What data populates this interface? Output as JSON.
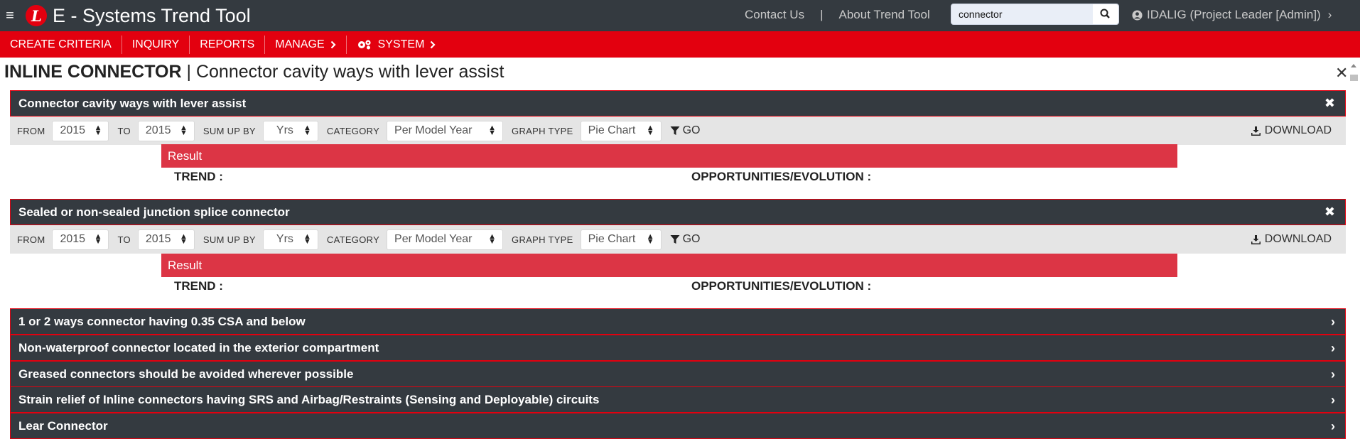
{
  "app": {
    "title": "E - Systems Trend Tool",
    "logo_letter": "L"
  },
  "header": {
    "contact_label": "Contact Us",
    "separator": "|",
    "about_label": "About Trend Tool",
    "search": {
      "value": "connector"
    },
    "user_label": "IDALIG (Project Leader [Admin])"
  },
  "nav": {
    "items": [
      {
        "label": "CREATE CRITERIA"
      },
      {
        "label": "INQUIRY"
      },
      {
        "label": "REPORTS"
      },
      {
        "label": "MANAGE"
      },
      {
        "label": "SYSTEM"
      }
    ]
  },
  "page": {
    "title_bold": "INLINE CONNECTOR",
    "title_sep": " | ",
    "title_rest": "Connector cavity ways with lever assist"
  },
  "labels": {
    "from": "FROM",
    "to": "TO",
    "sum_up_by": "SUM UP BY",
    "category": "CATEGORY",
    "graph_type": "GRAPH TYPE",
    "go": "GO",
    "download": "DOWNLOAD",
    "result": "Result",
    "trend": "TREND :",
    "opportunities": "OPPORTUNITIES/EVOLUTION :"
  },
  "sections": [
    {
      "title": "Connector cavity ways with lever assist",
      "from": "2015",
      "to": "2015",
      "sum_up_by": "Yrs",
      "category": "Per Model Year",
      "graph_type": "Pie Chart"
    },
    {
      "title": "Sealed or non-sealed junction splice connector",
      "from": "2015",
      "to": "2015",
      "sum_up_by": "Yrs",
      "category": "Per Model Year",
      "graph_type": "Pie Chart"
    }
  ],
  "collapsed": [
    {
      "title": "1 or 2 ways connector having 0.35 CSA and below"
    },
    {
      "title": "Non-waterproof connector located in the exterior compartment"
    },
    {
      "title": "Greased connectors should be avoided wherever possible"
    },
    {
      "title": "Strain relief of Inline connectors having SRS and Airbag/Restraints (Sensing and Deployable) circuits"
    },
    {
      "title": "Lear Connector"
    }
  ],
  "colors": {
    "brand_red": "#e3000f",
    "result_red": "#dc3545",
    "dark": "#343a40",
    "filter_bg": "#e5e5e5"
  }
}
